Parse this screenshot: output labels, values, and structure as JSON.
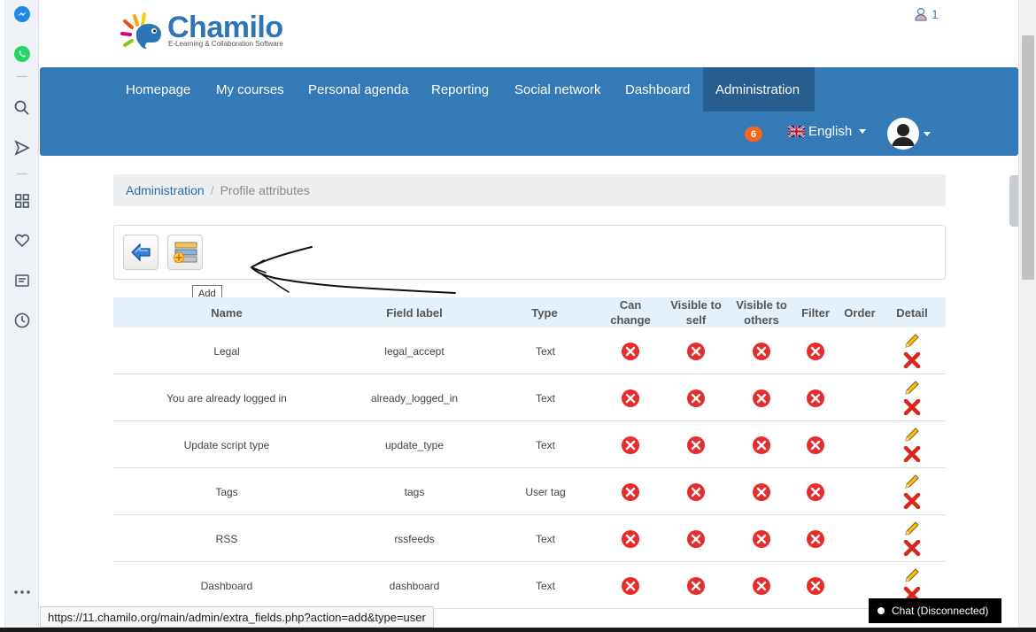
{
  "brand": {
    "name": "Chamilo",
    "tagline": "E-Learning & Collaboration Software"
  },
  "top_user": {
    "count": "1"
  },
  "nav": {
    "items": [
      {
        "label": "Homepage"
      },
      {
        "label": "My courses"
      },
      {
        "label": "Personal agenda"
      },
      {
        "label": "Reporting"
      },
      {
        "label": "Social network"
      },
      {
        "label": "Dashboard"
      },
      {
        "label": "Administration",
        "active": true
      }
    ],
    "notifications": "6",
    "language": "English"
  },
  "breadcrumb": {
    "parent": "Administration",
    "separator": "/",
    "current": "Profile attributes"
  },
  "toolbar": {
    "back_icon": "back-arrow-icon",
    "add_icon": "add-field-icon",
    "tooltip": "Add"
  },
  "table": {
    "headers": {
      "name": "Name",
      "field_label": "Field label",
      "type": "Type",
      "can_change": "Can change",
      "visible_self": "Visible to self",
      "visible_others": "Visible to others",
      "filter": "Filter",
      "order": "Order",
      "detail": "Detail"
    },
    "rows": [
      {
        "name": "Legal",
        "field_label": "legal_accept",
        "type": "Text"
      },
      {
        "name": "You are already logged in",
        "field_label": "already_logged_in",
        "type": "Text"
      },
      {
        "name": "Update script type",
        "field_label": "update_type",
        "type": "Text"
      },
      {
        "name": "Tags",
        "field_label": "tags",
        "type": "User tag"
      },
      {
        "name": "RSS",
        "field_label": "rssfeeds",
        "type": "Text"
      },
      {
        "name": "Dashboard",
        "field_label": "dashboard",
        "type": "Text"
      }
    ]
  },
  "status_bar": {
    "url": "https://11.chamilo.org/main/admin/extra_fields.php?action=add&type=user"
  },
  "chat": {
    "label": "Chat (Disconnected)"
  },
  "colors": {
    "navbar": "#337ab7",
    "navbar_active": "#265e8f",
    "badge": "#f5671f",
    "header_row": "#e4f1fb",
    "no_icon": "#e52d2d"
  }
}
